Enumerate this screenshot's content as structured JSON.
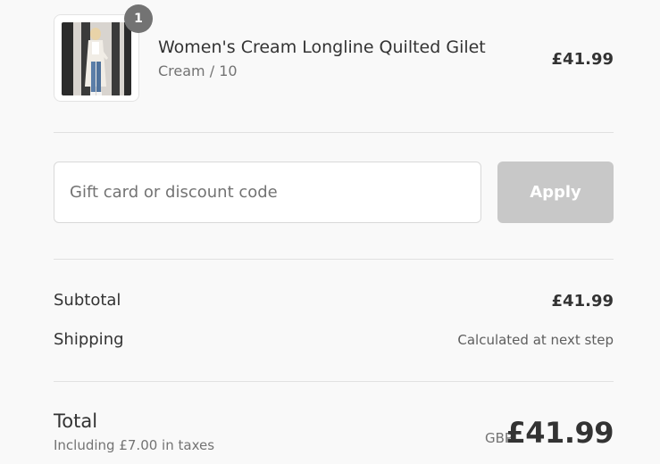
{
  "order_summary": {
    "product": {
      "title": "Women's Cream Longline Quilted Gilet",
      "variant": "Cream / 10",
      "price": "£41.99",
      "quantity": "1",
      "image_icon": "product-photo"
    },
    "discount": {
      "placeholder": "Gift card or discount code",
      "value": "",
      "apply_label": "Apply"
    },
    "subtotal": {
      "label": "Subtotal",
      "value": "£41.99"
    },
    "shipping": {
      "label": "Shipping",
      "value": "Calculated at next step"
    },
    "total": {
      "label": "Total",
      "tax_note": "Including £7.00 in taxes",
      "currency": "GBP",
      "amount": "£41.99"
    }
  },
  "colors": {
    "background": "#f9f9f9",
    "text": "#333333",
    "muted": "#737373",
    "apply_disabled": "#c8c8c8",
    "badge": "#737373"
  }
}
